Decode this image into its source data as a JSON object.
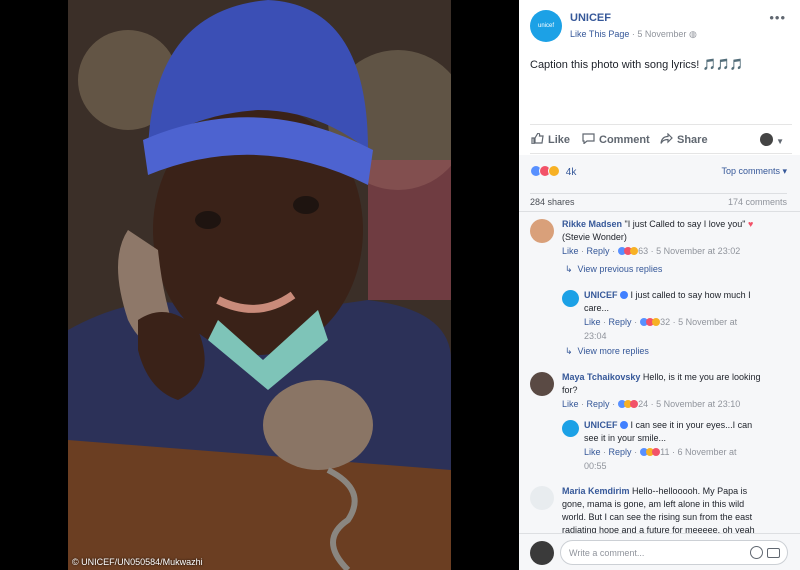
{
  "photo": {
    "credit": "© UNICEF/UN050584/Mukwazhi"
  },
  "post": {
    "page_name": "UNICEF",
    "avatar_text": "unicef",
    "like_page": "Like This Page",
    "date": "5 November",
    "caption": "Caption this photo with song lyrics!",
    "caption_emoji": "🎵🎵🎵"
  },
  "actions": {
    "like": "Like",
    "comment": "Comment",
    "share": "Share"
  },
  "summary": {
    "reaction_count": "4k",
    "top_comments": "Top comments ▾",
    "shares": "284 shares",
    "comments": "174 comments"
  },
  "comments": [
    {
      "name": "Rikke Madsen",
      "text": "\"I just Called to say I love you\"",
      "text2": "(Stevie Wonder)",
      "reactions": "63",
      "time": "5 November at 23:02"
    },
    {
      "name": "UNICEF",
      "text": "I just called to say how much I",
      "text2": "care...",
      "reactions": "32",
      "time": "5 November at",
      "time2": "23:04"
    },
    {
      "name": "Maya Tchaikovsky",
      "text": "Hello, is it me you are looking",
      "text2": "for?",
      "reactions": "24",
      "time": "5 November at 23:10"
    },
    {
      "name": "UNICEF",
      "text": "I can see it in your eyes...I can",
      "text2": "see it in your smile...",
      "reactions": "11",
      "time": "6 November at",
      "time2": "00:55"
    },
    {
      "name": "Maria Kemdirim",
      "text": "Hello--hellooooh. My Papa is",
      "text2": "gone, mama is gone, am left alone in this wild",
      "text3": "world. But I can see the rising sun from the east",
      "text4": "radiating hope and a future for meeeee. oh yeah"
    }
  ],
  "links": {
    "like": "Like",
    "reply": "Reply",
    "dot": "·",
    "view_previous": "View previous replies",
    "view_more": "View more replies"
  },
  "composer": {
    "placeholder": "Write a comment..."
  },
  "colors": {
    "link": "#365899",
    "unicef_blue": "#1ca1e6",
    "love": "#f25268"
  }
}
